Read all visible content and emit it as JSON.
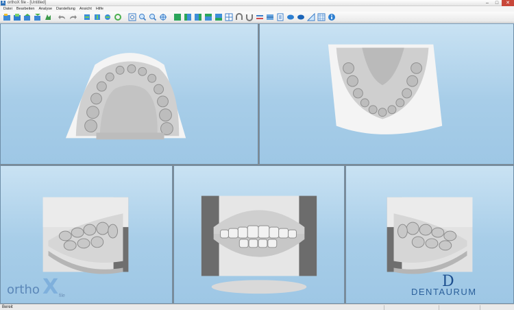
{
  "window": {
    "title": "orthoX file - [Untitled]",
    "minimize": "–",
    "maximize": "□",
    "close": "✕"
  },
  "menu": [
    "Datei",
    "Bearbeiten",
    "Analyse",
    "Darstellung",
    "Ansicht",
    "Hilfe"
  ],
  "toolbar": {
    "icons": [
      "open-icon",
      "save-icon",
      "export-icon",
      "import-icon",
      "model-icon",
      "undo-icon",
      "redo-icon",
      "rotate-left-icon",
      "rotate-right-icon",
      "rotate-model-icon",
      "refresh-icon",
      "zoom-fit-icon",
      "zoom-in-icon",
      "zoom-out-icon",
      "center-icon",
      "view-front-icon",
      "view-left-icon",
      "view-right-icon",
      "view-top-icon",
      "view-bottom-icon",
      "layout-icon",
      "arch-upper-icon",
      "arch-lower-icon",
      "occlusion-icon",
      "plane-icon",
      "measure-icon",
      "color-icon",
      "color2-icon",
      "ruler-icon",
      "grid-icon",
      "info-icon"
    ]
  },
  "statusbar": {
    "text": "Bereit"
  },
  "logos": {
    "ortho_word": "ortho",
    "ortho_x": "X",
    "ortho_file": "file",
    "dentaurum_mark": "D",
    "dentaurum_name": "DENTAURUM"
  },
  "colors": {
    "viewport_top": "#c9e2f3",
    "viewport_bottom": "#9ec7e5",
    "model": "#d9d9d9",
    "ortho_blue": "#7fb0dc",
    "dentaurum_blue": "#1c4e8e"
  }
}
